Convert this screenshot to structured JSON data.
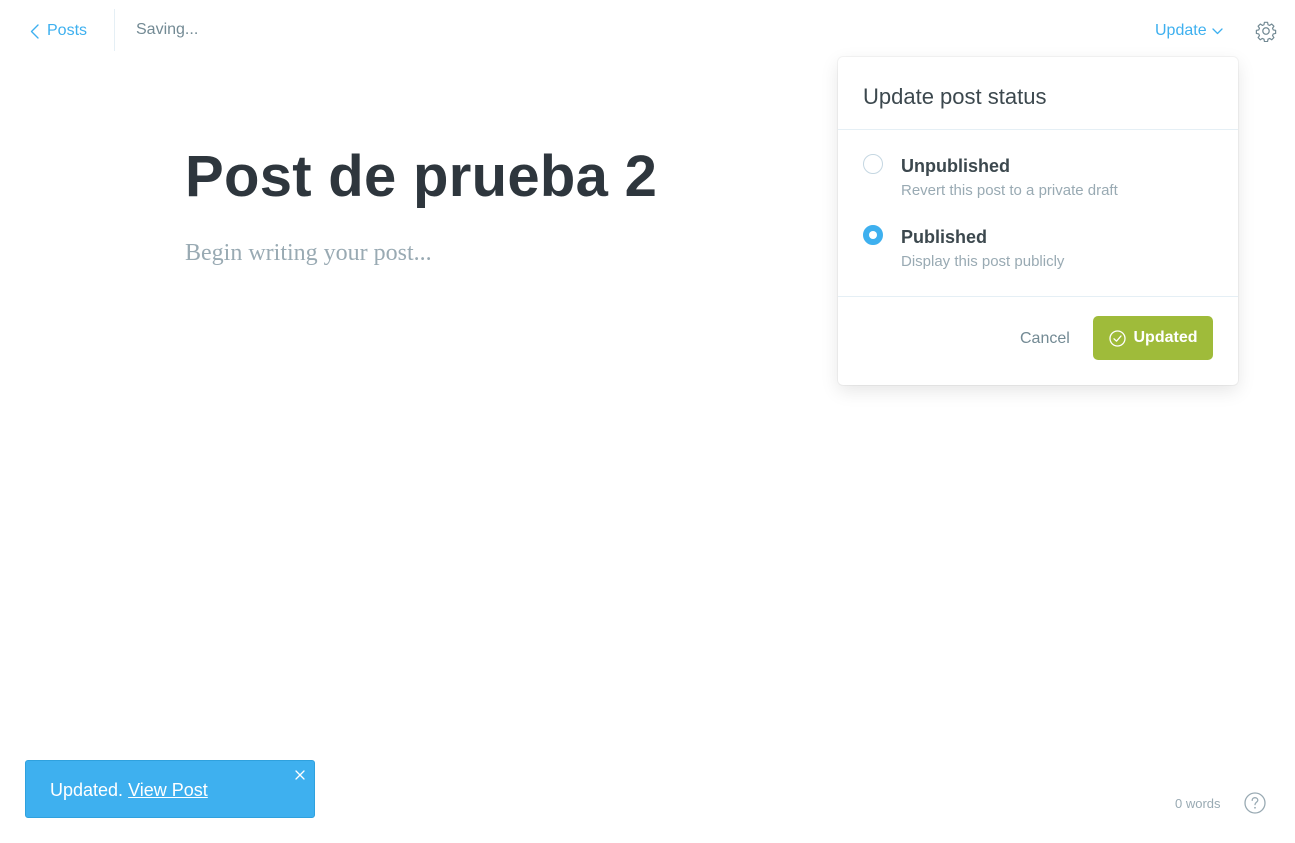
{
  "header": {
    "back_label": "Posts",
    "save_status": "Saving...",
    "update_label": "Update"
  },
  "post": {
    "title": "Post de prueba 2",
    "body_placeholder": "Begin writing your post..."
  },
  "publish_menu": {
    "heading": "Update post status",
    "options": [
      {
        "label": "Unpublished",
        "description": "Revert this post to a private draft",
        "selected": false
      },
      {
        "label": "Published",
        "description": "Display this post publicly",
        "selected": true
      }
    ],
    "cancel_label": "Cancel",
    "confirm_label": "Updated"
  },
  "notification": {
    "message": "Updated.",
    "link_label": "View Post"
  },
  "footer": {
    "word_count": "0 words"
  },
  "colors": {
    "accent": "#3eb0ef",
    "success": "#9fbb3a",
    "text": "#2e363d",
    "muted": "#99aab3"
  },
  "icons": {
    "back": "chevron-left-icon",
    "update_dropdown": "chevron-down-icon",
    "settings": "gear-icon",
    "confirm": "check-circle-icon",
    "close": "close-icon",
    "help": "question-circle-icon"
  }
}
